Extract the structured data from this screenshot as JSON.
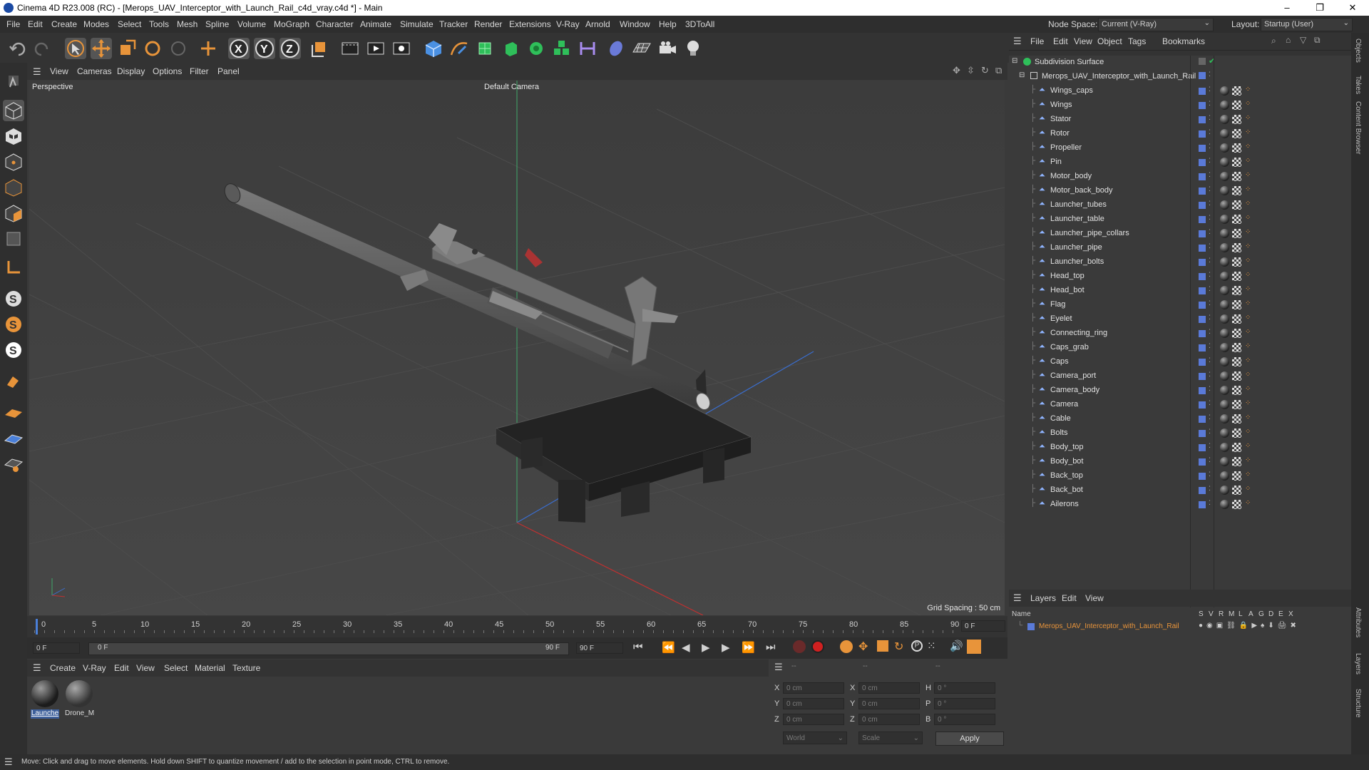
{
  "window": {
    "title": "Cinema 4D R23.008 (RC) - [Merops_UAV_Interceptor_with_Launch_Rail_c4d_vray.c4d *] - Main",
    "minimize": "–",
    "maximize": "❐",
    "close": "✕"
  },
  "menubar": {
    "items": [
      "File",
      "Edit",
      "Create",
      "Modes",
      "Select",
      "Tools",
      "Mesh",
      "Spline",
      "Volume",
      "MoGraph",
      "Character",
      "Animate",
      "Simulate",
      "Tracker",
      "Render",
      "Extensions",
      "V-Ray",
      "Arnold",
      "Window",
      "Help",
      "3DToAll"
    ],
    "node_space_label": "Node Space:",
    "node_space_value": "Current (V-Ray)",
    "layout_label": "Layout:",
    "layout_value": "Startup (User)"
  },
  "viewport": {
    "menu": [
      "View",
      "Cameras",
      "Display",
      "Options",
      "Filter",
      "Panel"
    ],
    "view_name": "Perspective",
    "camera_name": "Default Camera",
    "grid_spacing": "Grid Spacing : 50 cm"
  },
  "timeline": {
    "ticks": [
      "0",
      "5",
      "10",
      "15",
      "20",
      "25",
      "30",
      "35",
      "40",
      "45",
      "50",
      "55",
      "60",
      "65",
      "70",
      "75",
      "80",
      "85",
      "90"
    ],
    "current_frame_field": "0 F"
  },
  "transport": {
    "start_field": "0 F",
    "range_start": "0 F",
    "range_end": "90 F",
    "end_field": "90 F"
  },
  "materials": {
    "menu": [
      "Create",
      "V-Ray",
      "Edit",
      "View",
      "Select",
      "Material",
      "Texture"
    ],
    "items": [
      {
        "name": "Launche"
      },
      {
        "name": "Drone_M"
      }
    ]
  },
  "coords": {
    "header": [
      "--",
      "--",
      "--"
    ],
    "rows": [
      {
        "a": "X",
        "av": "0 cm",
        "b": "X",
        "bv": "0 cm",
        "c": "H",
        "cv": "0 °"
      },
      {
        "a": "Y",
        "av": "0 cm",
        "b": "Y",
        "bv": "0 cm",
        "c": "P",
        "cv": "0 °"
      },
      {
        "a": "Z",
        "av": "0 cm",
        "b": "Z",
        "bv": "0 cm",
        "c": "B",
        "cv": "0 °"
      }
    ],
    "world": "World",
    "scale": "Scale",
    "apply": "Apply"
  },
  "status": {
    "text": "Move: Click and drag to move elements. Hold down SHIFT to quantize movement / add to the selection in point mode, CTRL to remove."
  },
  "object_manager": {
    "menu": [
      "File",
      "Edit",
      "View",
      "Object",
      "Tags",
      "Bookmarks"
    ],
    "root": "Subdivision Surface",
    "group": "Merops_UAV_Interceptor_with_Launch_Rail",
    "objects": [
      "Wings_caps",
      "Wings",
      "Stator",
      "Rotor",
      "Propeller",
      "Pin",
      "Motor_body",
      "Motor_back_body",
      "Launcher_tubes",
      "Launcher_table",
      "Launcher_pipe_collars",
      "Launcher_pipe",
      "Launcher_bolts",
      "Head_top",
      "Head_bot",
      "Flag",
      "Eyelet",
      "Connecting_ring",
      "Caps_grab",
      "Caps",
      "Camera_port",
      "Camera_body",
      "Camera",
      "Cable",
      "Bolts",
      "Body_top",
      "Body_bot",
      "Back_top",
      "Back_bot",
      "Ailerons"
    ]
  },
  "layers": {
    "menu": [
      "Layers",
      "Edit",
      "View"
    ],
    "col_name": "Name",
    "cols": [
      "S",
      "V",
      "R",
      "M",
      "L",
      "A",
      "G",
      "D",
      "E",
      "X"
    ],
    "layer_name": "Merops_UAV_Interceptor_with_Launch_Rail",
    "layer_color": "#e07a2a"
  },
  "side_tabs": [
    "Objects",
    "Takes",
    "Content Browser",
    "Attributes",
    "Layers",
    "Structure"
  ],
  "colors": {
    "accent": "#4a7fd8",
    "orange": "#e8943a",
    "record": "#d02020"
  }
}
